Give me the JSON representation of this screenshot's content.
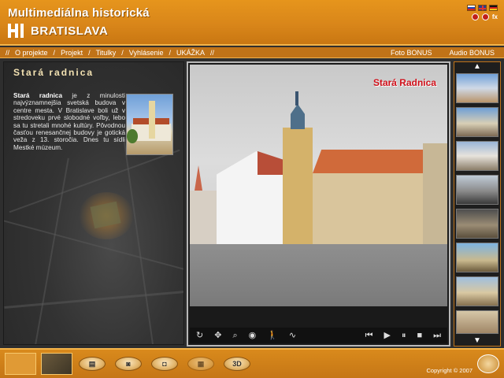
{
  "header": {
    "title": "Multimediálna historická",
    "city": "BRATISLAVA",
    "fx_label": "fx",
    "languages": [
      "sk-flag",
      "en-flag",
      "de-flag"
    ]
  },
  "nav": {
    "items": [
      {
        "label": "O projekte"
      },
      {
        "label": "Projekt"
      },
      {
        "label": "Titulky"
      },
      {
        "label": "Vyhlásenie"
      },
      {
        "label": "UKÁŽKA"
      }
    ],
    "right_items": [
      {
        "label": "Foto BONUS"
      },
      {
        "label": "Audio BONUS"
      }
    ]
  },
  "info": {
    "title": "Stará radnica",
    "text_bold": "Stará radnica",
    "text_rest": " je z minulosti najvýznamnejšia svetská budova v centre mesta. V Bratislave boli už v stredoveku prvé slobodné voľby, lebo sa tu stretali mnohé kultúry. Pôvodnou časťou renesančnej budovy je gotická veža z 13. storočia. Dnes tu sídli Mestké múzeum."
  },
  "viewer": {
    "scene_label": "Stará Radnica",
    "toolbar_left": [
      "rotate-icon",
      "move-icon",
      "zoom-icon",
      "eye-icon",
      "walk-icon",
      "path-icon"
    ],
    "toolbar_right": [
      "skip-back-icon",
      "play-icon",
      "pause-icon",
      "stop-icon",
      "skip-forward-icon"
    ]
  },
  "thumbnails": {
    "up_icon": "triangle-up-icon",
    "down_icon": "triangle-down-icon",
    "count": 8
  },
  "footer": {
    "copyright": "Copyright © 2007",
    "buttons": [
      "book-icon",
      "camera-icon",
      "video-camera-icon",
      "film-icon",
      "3D"
    ],
    "threeD": "3D"
  },
  "colors": {
    "accent": "#d9861a",
    "scene_label": "#d0101a"
  }
}
